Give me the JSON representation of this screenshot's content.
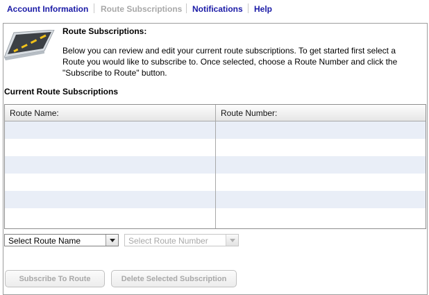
{
  "nav": {
    "items": [
      {
        "label": "Account Information",
        "state": "active"
      },
      {
        "label": "Route Subscriptions",
        "state": "current"
      },
      {
        "label": "Notifications",
        "state": "active"
      },
      {
        "label": "Help",
        "state": "active"
      }
    ]
  },
  "intro": {
    "title": "Route Subscriptions:",
    "text": "Below you can review and edit your current route subscriptions.  To get started first select a Route you would like to subscribe to.  Once selected, choose a Route Number and click the \"Subscribe to Route\" button.",
    "icon": "road-icon"
  },
  "subscriptions": {
    "title": "Current Route Subscriptions",
    "columns": [
      "Route Name:",
      "Route Number:"
    ],
    "rows": [
      {
        "name": "",
        "number": ""
      },
      {
        "name": "",
        "number": ""
      },
      {
        "name": "",
        "number": ""
      },
      {
        "name": "",
        "number": ""
      },
      {
        "name": "",
        "number": ""
      },
      {
        "name": "",
        "number": ""
      }
    ]
  },
  "controls": {
    "route_name_select": {
      "value": "Select Route Name",
      "enabled": true
    },
    "route_number_select": {
      "value": "Select Route Number",
      "enabled": false
    },
    "subscribe_button": {
      "label": "Subscribe To Route",
      "enabled": false
    },
    "delete_button": {
      "label": "Delete Selected Subscription",
      "enabled": false
    }
  },
  "colors": {
    "nav_link": "#1a1aa6",
    "disabled_text": "#a8a8a8",
    "alt_row": "#e9eef7"
  }
}
